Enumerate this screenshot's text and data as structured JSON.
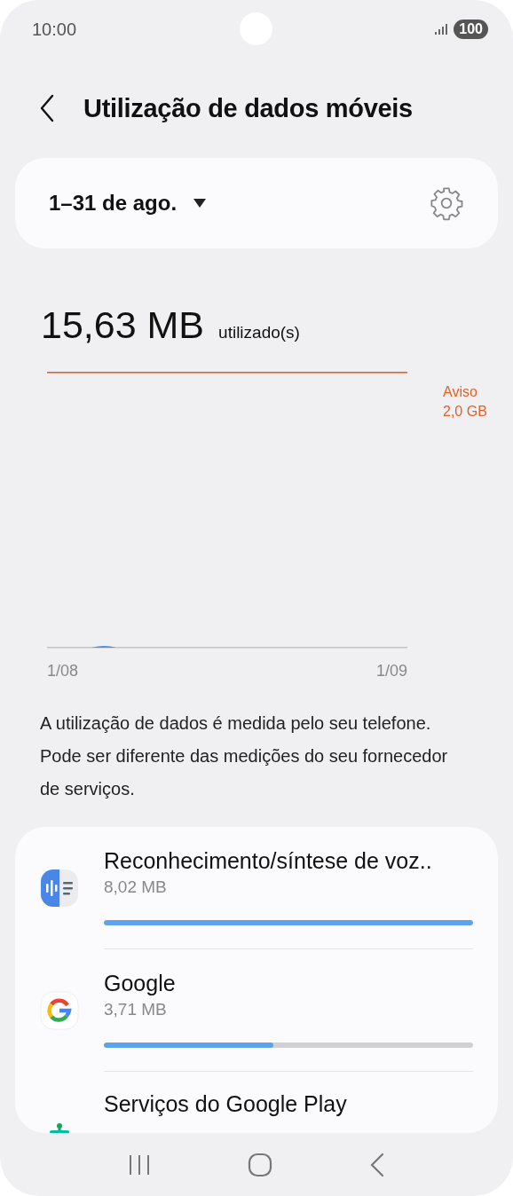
{
  "status_bar": {
    "time": "10:00",
    "battery": "100"
  },
  "header": {
    "title": "Utilização de dados móveis"
  },
  "period": {
    "label": "1–31 de ago."
  },
  "usage": {
    "amount": "15,63 MB",
    "unit": "utilizado(s)"
  },
  "chart": {
    "warning_label": "Aviso\n2,0 GB",
    "x_start": "1/08",
    "x_end": "1/09"
  },
  "description": "A utilização de dados é medida pelo seu telefone. Pode ser diferente das medições do seu fornecedor de serviços.",
  "apps": [
    {
      "kind": "voice",
      "name": "Reconhecimento/síntese de voz..",
      "size": "8,02 MB",
      "level": 1.0
    },
    {
      "kind": "google",
      "name": "Google",
      "size": "3,71 MB",
      "level": 0.46
    },
    {
      "kind": "play",
      "name": "Serviços do Google Play"
    }
  ]
}
